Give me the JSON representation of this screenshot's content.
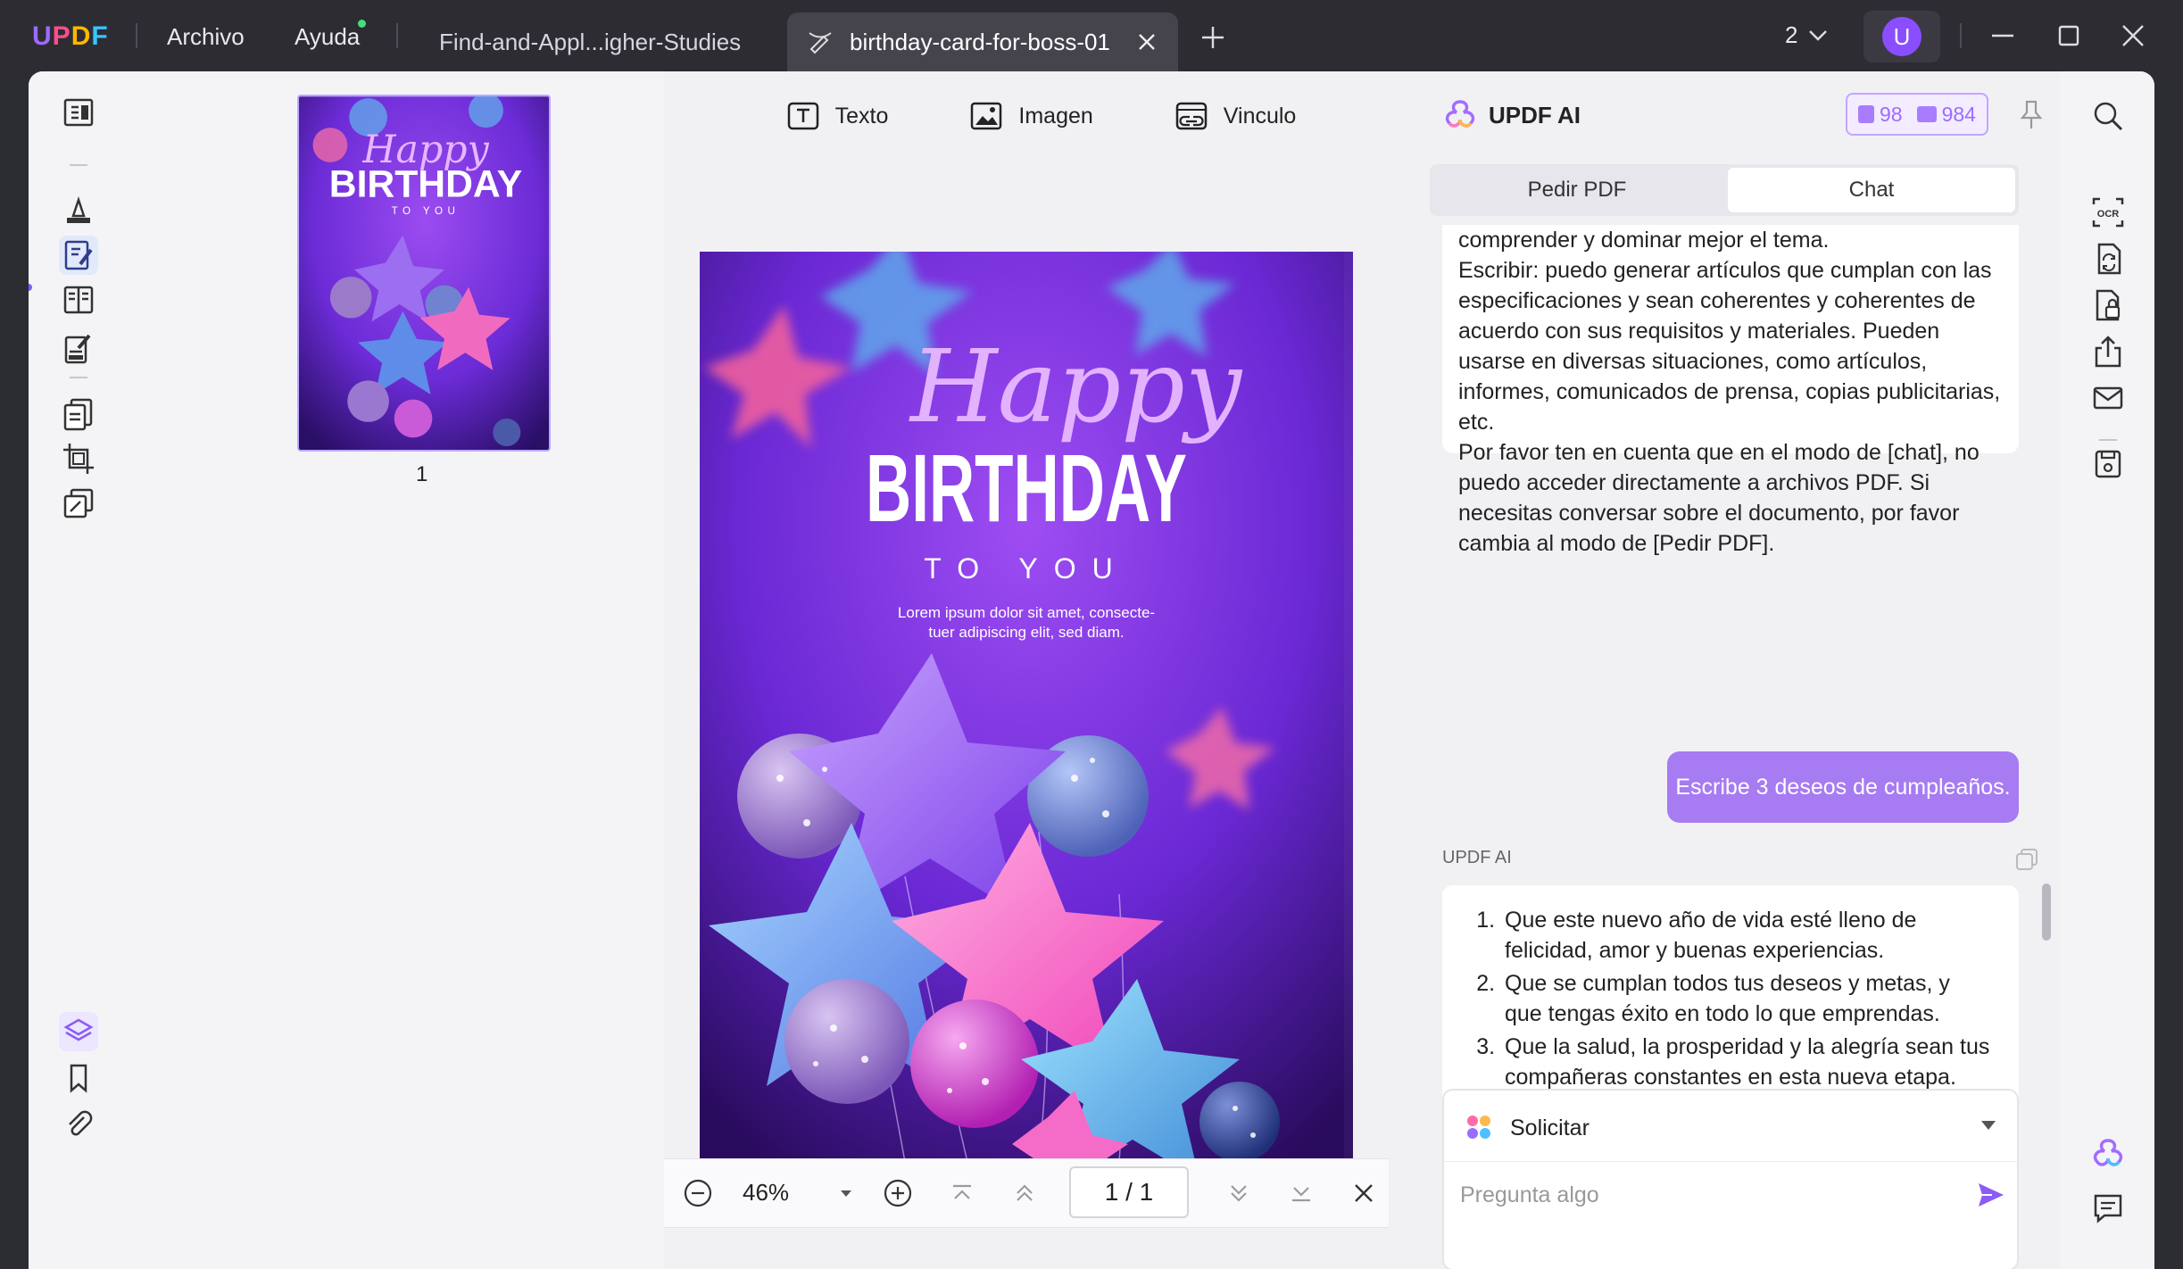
{
  "app": {
    "menus": [
      "Archivo",
      "Ayuda"
    ],
    "tabs": [
      {
        "label": "Find-and-Appl...igher-Studies"
      },
      {
        "label": "birthday-card-for-boss-01"
      }
    ],
    "window_count": "2",
    "user_initial": "U",
    "colors": {
      "accent": "#8a4dff",
      "titlebar": "#2d2c33",
      "user_bubble": "#a77bf2"
    }
  },
  "thumbnail": {
    "page_number": "1"
  },
  "doc_toolbar": {
    "text": "Texto",
    "image": "Imagen",
    "link": "Vinculo"
  },
  "card": {
    "happy": "Happy",
    "birthday": "BIRTHDAY",
    "to_you": "TO YOU",
    "lorem_1": "Lorem ipsum dolor sit amet, consecte-",
    "lorem_2": "tuer adipiscing elit, sed diam."
  },
  "zoombar": {
    "zoom": "46%",
    "page_indicator": "1 / 1"
  },
  "ai": {
    "title": "UPDF AI",
    "quota_pdf": "98",
    "quota_chat": "984",
    "segments": {
      "ask_pdf": "Pedir PDF",
      "chat": "Chat"
    },
    "prev_answer": [
      "comprender y dominar mejor el tema.",
      "Escribir: puedo generar artículos que cumplan con las especificaciones y sean coherentes y coherentes de acuerdo con sus requisitos y materiales. Pueden usarse en diversas situaciones, como artículos, informes, comunicados de prensa, copias publicitarias, etc.",
      "Por favor ten en cuenta que en el modo de [chat], no puedo acceder directamente a archivos PDF. Si necesitas conversar sobre el documento, por favor cambia al modo de [Pedir PDF]."
    ],
    "user_message": "Escribe 3 deseos de cumpleaños.",
    "assistant_label": "UPDF AI",
    "wishes": [
      "Que este nuevo año de vida esté lleno de felicidad, amor y buenas experiencias.",
      "Que se cumplan todos tus deseos y metas, y que tengas éxito en todo lo que emprendas.",
      "Que la salud, la prosperidad y la alegría sean tus compañeras constantes en esta nueva etapa. ¡Feliz cumpleaños!"
    ],
    "prompt_mode": "Solicitar",
    "input_placeholder": "Pregunta algo"
  }
}
